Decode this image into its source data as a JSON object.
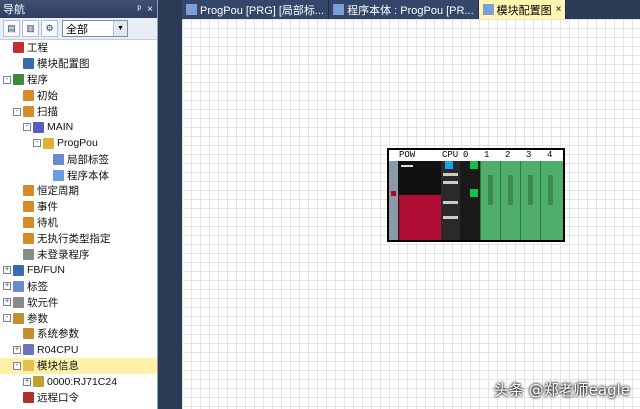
{
  "nav": {
    "title": "导航",
    "pin_symbol": "ᵖ",
    "close_symbol": "×",
    "filter_value": "全部",
    "tree": [
      {
        "label": "工程",
        "level": 0,
        "expander": "",
        "icon": "project-icon"
      },
      {
        "label": "模块配置图",
        "level": 1,
        "expander": "",
        "icon": "module-config-icon"
      },
      {
        "label": "程序",
        "level": 0,
        "expander": "-",
        "icon": "program-icon"
      },
      {
        "label": "初始",
        "level": 1,
        "expander": "",
        "icon": "task-icon"
      },
      {
        "label": "扫描",
        "level": 1,
        "expander": "-",
        "icon": "task-icon"
      },
      {
        "label": "MAIN",
        "level": 2,
        "expander": "-",
        "icon": "main-program-icon"
      },
      {
        "label": "ProgPou",
        "level": 3,
        "expander": "-",
        "icon": "pou-icon"
      },
      {
        "label": "局部标签",
        "level": 4,
        "expander": "",
        "icon": "local-label-icon"
      },
      {
        "label": "程序本体",
        "level": 4,
        "expander": "",
        "icon": "program-body-icon"
      },
      {
        "label": "恒定周期",
        "level": 1,
        "expander": "",
        "icon": "task-icon"
      },
      {
        "label": "事件",
        "level": 1,
        "expander": "",
        "icon": "task-icon"
      },
      {
        "label": "待机",
        "level": 1,
        "expander": "",
        "icon": "task-icon"
      },
      {
        "label": "无执行类型指定",
        "level": 1,
        "expander": "",
        "icon": "task-icon"
      },
      {
        "label": "未登录程序",
        "level": 1,
        "expander": "",
        "icon": "unregistered-icon"
      },
      {
        "label": "FB/FUN",
        "level": 0,
        "expander": "+",
        "icon": "fb-icon"
      },
      {
        "label": "标签",
        "level": 0,
        "expander": "+",
        "icon": "label-icon"
      },
      {
        "label": "软元件",
        "level": 0,
        "expander": "+",
        "icon": "device-icon"
      },
      {
        "label": "参数",
        "level": 0,
        "expander": "-",
        "icon": "parameter-icon"
      },
      {
        "label": "系统参数",
        "level": 1,
        "expander": "",
        "icon": "system-param-icon"
      },
      {
        "label": "R04CPU",
        "level": 1,
        "expander": "+",
        "icon": "cpu-icon"
      },
      {
        "label": "模块信息",
        "level": 1,
        "expander": "-",
        "icon": "module-info-icon",
        "selected": true
      },
      {
        "label": "0000:RJ71C24",
        "level": 2,
        "expander": "+",
        "icon": "module-icon"
      },
      {
        "label": "远程口令",
        "level": 1,
        "expander": "",
        "icon": "remote-password-icon"
      }
    ]
  },
  "tabs": [
    {
      "label": "ProgPou [PRG] [局部标...",
      "active": false
    },
    {
      "label": "程序本体 : ProgPou [PR...",
      "active": false
    },
    {
      "label": "模块配置图",
      "active": true,
      "close": "×"
    }
  ],
  "rack": {
    "slot_labels": [
      "POW",
      "CPU",
      "0",
      "1",
      "2",
      "3",
      "4"
    ]
  },
  "watermark": "头条 @郑老师eagle",
  "colors": {
    "title_bar": "#2e3f60",
    "selection": "#fff2a8",
    "active_tab": "#fff4b0",
    "power_red": "#b00d35",
    "slot_green": "#4fae6a"
  }
}
